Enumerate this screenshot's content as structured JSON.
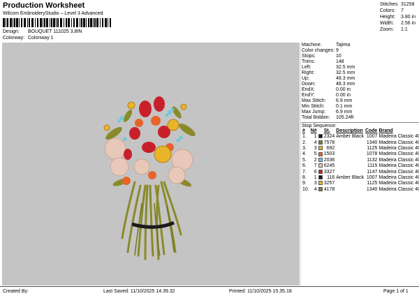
{
  "header": {
    "title": "Production Worksheet",
    "subtitle": "Wilcom EmbroideryStudio – Level 3 Advanced",
    "design_label": "Design:",
    "design_value": "BOUQUET 111025 3,8IN",
    "colorway_label": "Colorway:",
    "colorway_value": "Colonway 1"
  },
  "stats": [
    {
      "label": "Stitches:",
      "value": "31258"
    },
    {
      "label": "Colors:",
      "value": "7"
    },
    {
      "label": "Height:",
      "value": "3.80 in"
    },
    {
      "label": "Width:",
      "value": "2.56 in"
    },
    {
      "label": "Zoom:",
      "value": "1:1"
    }
  ],
  "info": [
    {
      "label": "Machine:",
      "value": "Tajima"
    },
    {
      "label": "Color changes:",
      "value": "9"
    },
    {
      "label": "Stops:",
      "value": "10"
    },
    {
      "label": "Trims:",
      "value": "148"
    },
    {
      "label": "Left:",
      "value": "32.5 mm"
    },
    {
      "label": "Right:",
      "value": "32.5 mm"
    },
    {
      "label": "Up:",
      "value": "48.3 mm"
    },
    {
      "label": "Down:",
      "value": "48.3 mm"
    },
    {
      "label": "EndX:",
      "value": "0.00 in"
    },
    {
      "label": "EndY:",
      "value": "0.00 in"
    },
    {
      "label": "Max Stitch:",
      "value": "6.9 mm"
    },
    {
      "label": "Min Stitch:",
      "value": "0.1 mm"
    },
    {
      "label": "Max Jump:",
      "value": "6.9 mm"
    },
    {
      "label": "Total Bobbin:",
      "value": "105.24ft"
    }
  ],
  "stop_sequence": {
    "title": "Stop Sequence:",
    "headers": [
      "#",
      "N#",
      "",
      "St.",
      "Description",
      "Code",
      "Brand"
    ],
    "rows": [
      {
        "n": "1.",
        "needle": "1",
        "color": "#1a1a1a",
        "st": "2324",
        "desc": "Amber Black",
        "code": "1007",
        "brand": "Madeira Classic 40"
      },
      {
        "n": "2.",
        "needle": "4",
        "color": "#8a7a3a",
        "st": "7578",
        "desc": "",
        "code": "1340",
        "brand": "Madeira Classic 40"
      },
      {
        "n": "3.",
        "needle": "3",
        "color": "#e8b42a",
        "st": "692",
        "desc": "",
        "code": "1125",
        "brand": "Madeira Classic 40"
      },
      {
        "n": "4.",
        "needle": "5",
        "color": "#e8632a",
        "st": "1503",
        "desc": "",
        "code": "1078",
        "brand": "Madeira Classic 40"
      },
      {
        "n": "5.",
        "needle": "2",
        "color": "#6ec6e0",
        "st": "2036",
        "desc": "",
        "code": "1132",
        "brand": "Madeira Classic 40"
      },
      {
        "n": "6.",
        "needle": "7",
        "color": "#e8c8b8",
        "st": "6245",
        "desc": "",
        "code": "1115",
        "brand": "Madeira Classic 40"
      },
      {
        "n": "7.",
        "needle": "6",
        "color": "#c8202a",
        "st": "3327",
        "desc": "",
        "code": "1147",
        "brand": "Madeira Classic 40"
      },
      {
        "n": "8.",
        "needle": "1",
        "color": "#1a1a1a",
        "st": "116",
        "desc": "Amber Black",
        "code": "1007",
        "brand": "Madeira Classic 40"
      },
      {
        "n": "9.",
        "needle": "3",
        "color": "#e8b42a",
        "st": "3257",
        "desc": "",
        "code": "1125",
        "brand": "Madeira Classic 40"
      },
      {
        "n": "10.",
        "needle": "4",
        "color": "#8a7a3a",
        "st": "4178",
        "desc": "",
        "code": "1340",
        "brand": "Madeira Classic 40"
      }
    ]
  },
  "footer": {
    "created": "Created By:",
    "saved": "Last Saved: 11/10/2025 14.39.32",
    "printed": "Printed: 11/10/2025 15.35.18",
    "page": "Page 1 of 1"
  }
}
